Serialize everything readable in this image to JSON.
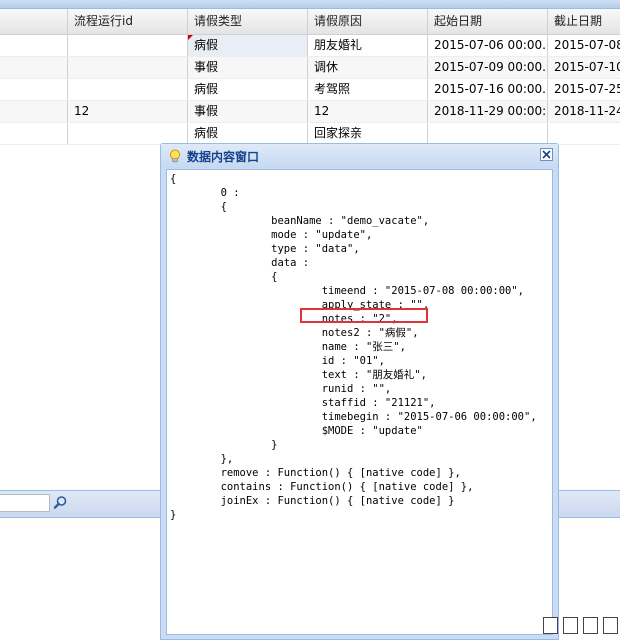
{
  "grid": {
    "columns": [
      "",
      "流程运行id",
      "请假类型",
      "请假原因",
      "起始日期",
      "截止日期"
    ],
    "rows": [
      [
        "",
        "",
        "病假",
        "朋友婚礼",
        "2015-07-06 00:00...",
        "2015-07-08 0"
      ],
      [
        "",
        "",
        "事假",
        "调休",
        "2015-07-09 00:00...",
        "2015-07-10 0"
      ],
      [
        "",
        "",
        "病假",
        "考驾照",
        "2015-07-16 00:00...",
        "2015-07-25 0"
      ],
      [
        "",
        "12",
        "事假",
        "12",
        "2018-11-29 00:00:...",
        "2018-11-24 0"
      ],
      [
        "",
        "",
        "病假",
        "回家探亲",
        "",
        ""
      ]
    ]
  },
  "window": {
    "title": "数据内容窗口",
    "content_lines": [
      "{",
      "        0 :",
      "        {",
      "                beanName : \"demo_vacate\",",
      "                mode : \"update\",",
      "                type : \"data\",",
      "                data :",
      "                {",
      "                        timeend : \"2015-07-08 00:00:00\",",
      "                        apply_state : \"\",",
      "                        notes : \"2\",",
      "                        notes2 : \"病假\",",
      "                        name : \"张三\",",
      "                        id : \"01\",",
      "                        text : \"朋友婚礼\",",
      "                        runid : \"\",",
      "                        staffid : \"21121\",",
      "                        timebegin : \"2015-07-06 00:00:00\",",
      "                        $MODE : \"update\"",
      "                }",
      "        },",
      "        remove : Function() { [native code] },",
      "        contains : Function() { [native code] },",
      "        joinEx : Function() { [native code] }",
      "}"
    ]
  },
  "icons": {
    "title_icon": "lightbulb-icon",
    "close_icon": "close-icon",
    "search_icon": "search-icon"
  },
  "colors": {
    "highlight_box": "#e0323a",
    "title_text": "#15428b",
    "window_frame": "#cbdcf2"
  }
}
